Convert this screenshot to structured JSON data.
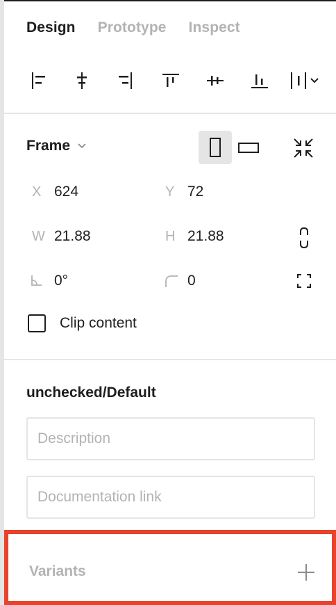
{
  "tabs": [
    {
      "label": "Design",
      "active": true
    },
    {
      "label": "Prototype",
      "active": false
    },
    {
      "label": "Inspect",
      "active": false
    }
  ],
  "alignment": {
    "icons": [
      "align-left-icon",
      "align-horizontal-center-icon",
      "align-right-icon",
      "align-top-icon",
      "align-vertical-center-icon",
      "align-bottom-icon",
      "distribute-spacing-icon"
    ]
  },
  "frame": {
    "label": "Frame",
    "x_label": "X",
    "x": "624",
    "y_label": "Y",
    "y": "72",
    "w_label": "W",
    "w": "21.88",
    "h_label": "H",
    "h": "21.88",
    "rotation": "0°",
    "radius": "0",
    "clip_label": "Clip content",
    "clip_checked": false
  },
  "component": {
    "name": "unchecked/Default",
    "description_placeholder": "Description",
    "doc_link_placeholder": "Documentation link"
  },
  "variants": {
    "label": "Variants"
  },
  "colors": {
    "highlight": "#e8432d",
    "text": "#1e1e1e",
    "muted": "#b3b3b3",
    "divider": "#e6e6e6"
  }
}
